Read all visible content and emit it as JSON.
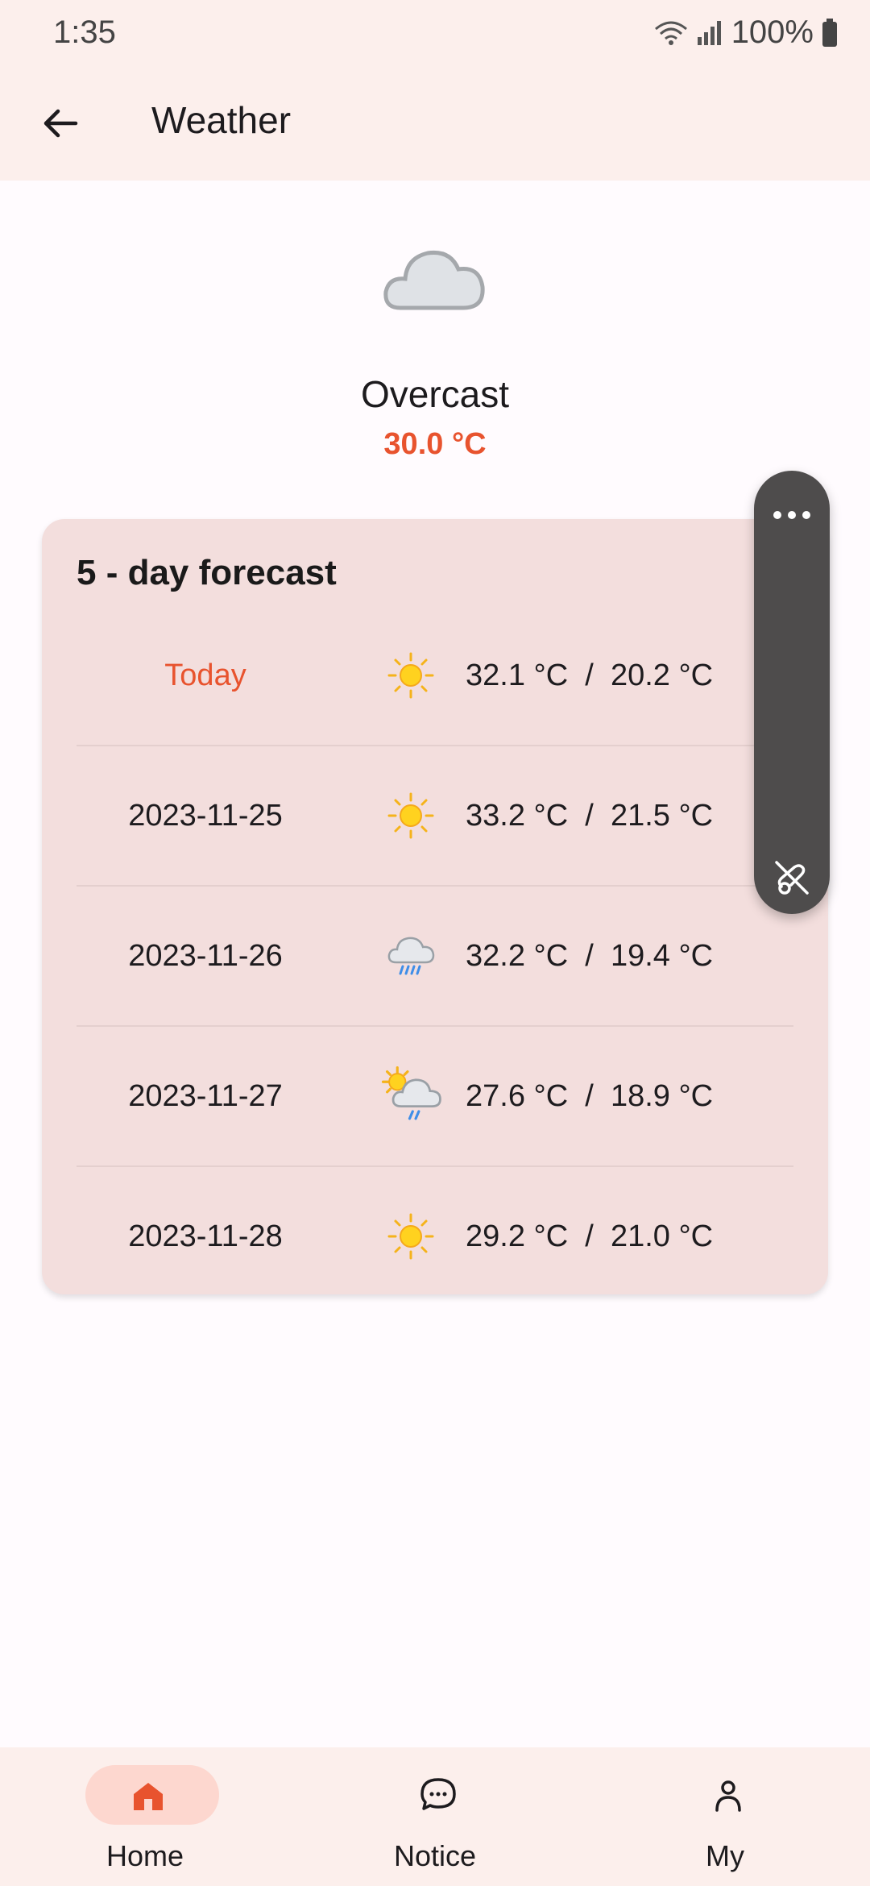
{
  "status_bar": {
    "time": "1:35",
    "battery": "100%"
  },
  "app_bar": {
    "title": "Weather",
    "back_icon": "arrow-left-icon"
  },
  "current": {
    "condition": "Overcast",
    "temperature": "30.0 °C",
    "icon": "cloud-icon"
  },
  "forecast": {
    "title": "5 - day forecast",
    "days": [
      {
        "date": "Today",
        "icon": "sun-icon",
        "temps": "32.1 °C  /  20.2 °C"
      },
      {
        "date": "2023-11-25",
        "icon": "sun-icon",
        "temps": "33.2 °C  /  21.5 °C"
      },
      {
        "date": "2023-11-26",
        "icon": "rain-cloud-icon",
        "temps": "32.2 °C  /  19.4 °C"
      },
      {
        "date": "2023-11-27",
        "icon": "sun-cloud-rain-icon",
        "temps": "27.6 °C  /  18.9 °C"
      },
      {
        "date": "2023-11-28",
        "icon": "sun-icon",
        "temps": "29.2 °C  /  21.0 °C"
      }
    ]
  },
  "bottom_nav": {
    "items": [
      {
        "label": "Home",
        "icon": "home-icon",
        "active": true
      },
      {
        "label": "Notice",
        "icon": "chat-bubble-icon",
        "active": false
      },
      {
        "label": "My",
        "icon": "person-icon",
        "active": false
      }
    ]
  },
  "colors": {
    "accent": "#e8532e",
    "card": "#f3dedd",
    "bar": "#fcefec"
  }
}
